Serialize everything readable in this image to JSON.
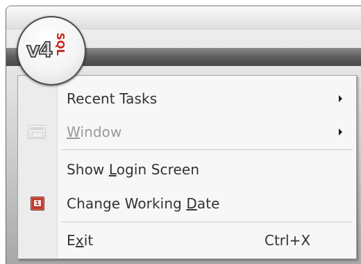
{
  "app": {
    "logo_main": "v4",
    "logo_suffix": "SQL"
  },
  "menu": {
    "items": [
      {
        "label": "Recent Tasks",
        "has_submenu": true,
        "enabled": true
      },
      {
        "label_pre": "",
        "label_ul": "W",
        "label_post": "indow",
        "has_submenu": true,
        "enabled": false,
        "icon": "window-icon"
      },
      {
        "label_pre": "Show ",
        "label_ul": "L",
        "label_post": "ogin Screen",
        "enabled": true
      },
      {
        "label_pre": "Change Working ",
        "label_ul": "D",
        "label_post": "ate",
        "enabled": true,
        "icon": "calendar-icon",
        "icon_text": "1"
      },
      {
        "label_pre": "E",
        "label_ul": "x",
        "label_post": "it",
        "shortcut": "Ctrl+X",
        "enabled": true
      }
    ]
  },
  "colors": {
    "menu_bg": "#f7f7f7",
    "gutter_bg": "#ececec",
    "text": "#333333",
    "disabled_text": "#9a9a9a",
    "logo_red": "#c8261b"
  }
}
